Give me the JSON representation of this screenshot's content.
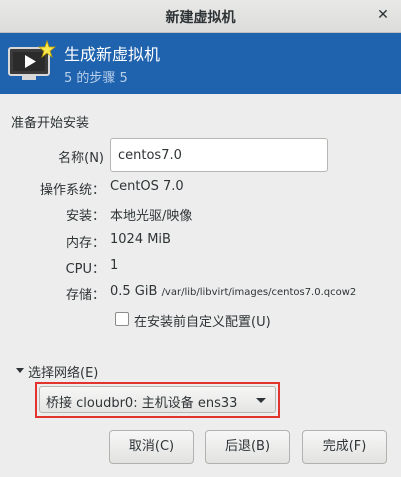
{
  "window": {
    "title": "新建虚拟机"
  },
  "banner": {
    "title": "生成新虚拟机",
    "step": "5 的步骤 5"
  },
  "section_title": "准备开始安装",
  "fields": {
    "name_label": "名称(N)",
    "name_value": "centos7.0",
    "os_label": "操作系统：",
    "os_value": "CentOS 7.0",
    "install_label": "安装：",
    "install_value": "本地光驱/映像",
    "memory_label": "内存：",
    "memory_value": "1024 MiB",
    "cpu_label": "CPU：",
    "cpu_value": "1",
    "storage_label": "存储：",
    "storage_size": "0.5 GiB",
    "storage_path": "/var/lib/libvirt/images/centos7.0.qcow2"
  },
  "customize_checkbox": {
    "label": "在安装前自定义配置(U)",
    "checked": false
  },
  "network": {
    "expander_label": "选择网络(E)",
    "selected": "桥接 cloudbr0: 主机设备 ens33"
  },
  "buttons": {
    "cancel": "取消(C)",
    "back": "后退(B)",
    "finish": "完成(F)"
  },
  "colors": {
    "banner": "#1f62ad",
    "highlight": "#e2332f"
  }
}
